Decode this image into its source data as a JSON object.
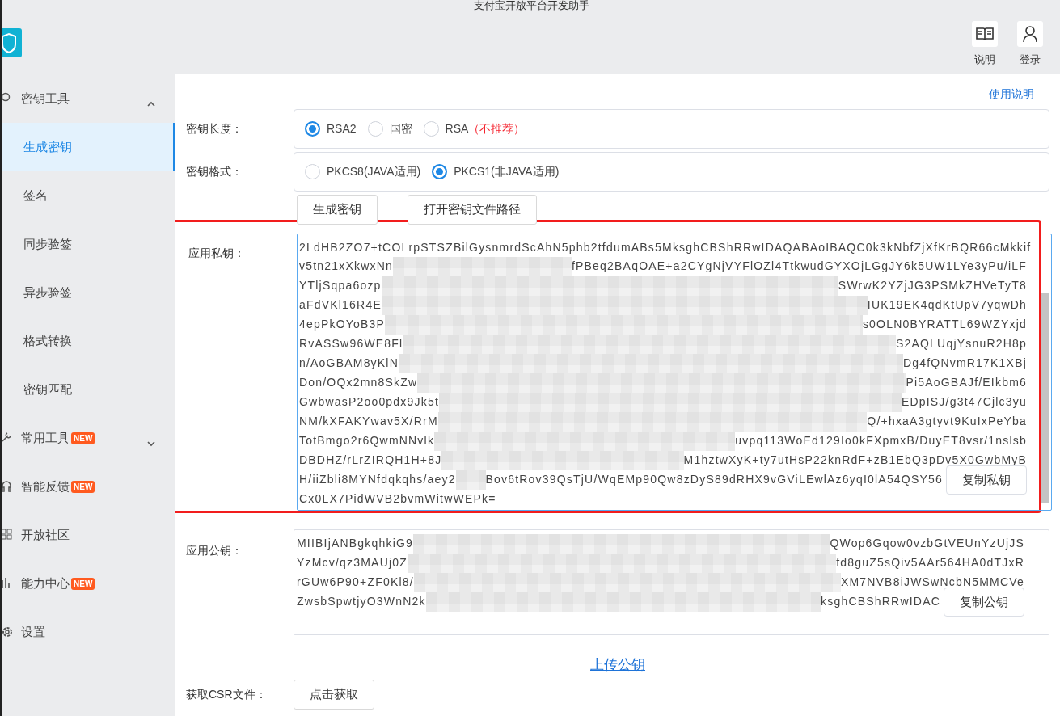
{
  "window": {
    "title": "支付宝开放平台开发助手"
  },
  "header": {
    "actions": [
      {
        "label": "说明"
      },
      {
        "label": "登录"
      }
    ]
  },
  "sidebar": {
    "items": [
      {
        "kind": "group",
        "label": "密钥工具",
        "expanded": true,
        "children": [
          {
            "label": "生成密钥",
            "selected": true
          },
          {
            "label": "签名",
            "selected": false
          },
          {
            "label": "同步验签",
            "selected": false
          },
          {
            "label": "异步验签",
            "selected": false
          },
          {
            "label": "格式转换",
            "selected": false
          },
          {
            "label": "密钥匹配",
            "selected": false
          }
        ]
      },
      {
        "kind": "group",
        "label": "常用工具",
        "badge": "NEW",
        "expanded": false
      },
      {
        "kind": "link",
        "label": "智能反馈",
        "badge": "NEW"
      },
      {
        "kind": "link",
        "label": "开放社区"
      },
      {
        "kind": "link",
        "label": "能力中心",
        "badge": "NEW"
      },
      {
        "kind": "link",
        "label": "设置"
      }
    ]
  },
  "main": {
    "help_link": "使用说明",
    "options": [
      {
        "label": "密钥长度：",
        "choices": [
          {
            "label": "RSA2",
            "selected": true
          },
          {
            "label": "国密",
            "selected": false
          },
          {
            "label": "RSA",
            "note": "（不推荐）",
            "selected": false
          }
        ]
      },
      {
        "label": "密钥格式：",
        "choices": [
          {
            "label": "PKCS8(JAVA适用)",
            "selected": false
          },
          {
            "label": "PKCS1(非JAVA适用)",
            "selected": true
          }
        ]
      }
    ],
    "buttons": [
      "生成密钥",
      "打开密钥文件路径"
    ],
    "private_key": {
      "label": "应用私钥：",
      "copy_button": "复制私钥",
      "highlighted": true,
      "lines": [
        {
          "kind": "full",
          "text": "2LdHB2ZO7+tCOLrpSTSZBilGysnmrdScAhN5phb2tfdumABs5MksghCBShRRwIDAQABAoIBAQC0k3kNbfZjXfKrBQR66cMkkif"
        },
        {
          "kind": "redacted",
          "left": "v5tn21xXkwxNn",
          "right": "fPBeq2BAqOAE+a2CYgNjVYFlOZl4TtkwudGYXOjLGgJY6k5UW1LYe3yPu/iLF"
        },
        {
          "kind": "redacted",
          "left": "YTljSqpa6ozp",
          "right": "SWrwK2YZjJG3PSMkZHVeTyT8"
        },
        {
          "kind": "redacted",
          "left": "aFdVKl16R4E",
          "right": "IUK19EK4qdKtUpV7yqwDh"
        },
        {
          "kind": "redacted",
          "left": "4epPkOYoB3P",
          "right": "s0OLN0BYRATTL69WZYxjd"
        },
        {
          "kind": "redacted",
          "left": "RvASSw96WE8Fl",
          "right": "S2AQLUqjYsnuR2H8p"
        },
        {
          "kind": "redacted",
          "left": "n/AoGBAM8yKlN",
          "right": "Dg4fQNvmR17K1XBj"
        },
        {
          "kind": "redacted",
          "left": "Don/OQx2mn8SkZw",
          "right": "Pi5AoGBAJf/EIkbm6"
        },
        {
          "kind": "redacted",
          "left": "GwbwasP2oo0pdx9Jk5t",
          "right": "EDpISJ/g3t47Cjlc3yu"
        },
        {
          "kind": "redacted",
          "left": "NM/kXFAKYwav5X/RrM",
          "right": "Q/+hxaA3gtyvt9KuIxPeYba"
        },
        {
          "kind": "redacted",
          "left": "TotBmgo2r6QwmNNvlk",
          "right": "uvpq113WoEd129Io0kFXpmxB/DuyET8vsr/1nslsb"
        },
        {
          "kind": "redacted",
          "left": "DBDHZ/rLrZIRQH1H+8J",
          "right": "M1hztwXyK+ty7utHsP22knRdF+zB1EbQ3pDv5X0GwbMyB"
        },
        {
          "kind": "redacted",
          "left": "H/iiZbli8MYNfdqkqhs/aey2",
          "right": "Bov6tRov39QsTjU/WqEMp90Qw8zDyS89dRHX9vGViLEwlAz6yqI0lA54QSY56"
        },
        {
          "kind": "full",
          "text": "Cx0LX7PidWVB2bvmWitwWEPk="
        }
      ]
    },
    "public_key": {
      "label": "应用公钥：",
      "copy_button": "复制公钥",
      "lines": [
        {
          "kind": "redacted",
          "left": "MIIBIjANBgkqhkiG9",
          "right": "QWop6Gqow0vzbGtVEUnYzUjJS"
        },
        {
          "kind": "redacted",
          "left": "YzMcv/qz3MAUj0Z",
          "right": "fd8guZ5sQiv5AAr564HA0dTJxR"
        },
        {
          "kind": "redacted",
          "left": "rGUw6P90+ZF0Kl8/",
          "right": "XM7NVB8iJWSwNcbN5MMCVe"
        },
        {
          "kind": "redacted",
          "left": "ZwsbSpwtjyO3WnN2k",
          "right": "ksghCBShRRwIDAC"
        }
      ]
    },
    "upload_link": "上传公钥",
    "csr": {
      "label": "获取CSR文件：",
      "button": "点击获取"
    }
  }
}
